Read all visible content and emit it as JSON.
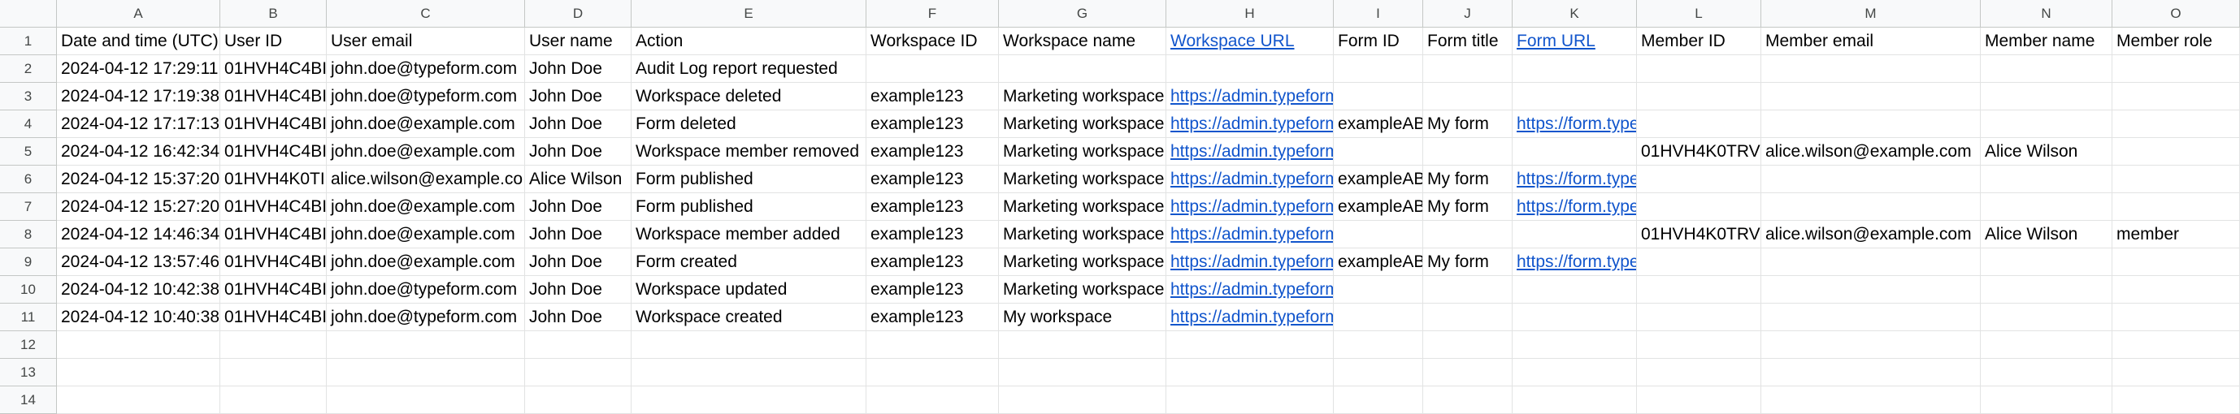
{
  "columns": [
    "A",
    "B",
    "C",
    "D",
    "E",
    "F",
    "G",
    "H",
    "I",
    "J",
    "K",
    "L",
    "M",
    "N",
    "O"
  ],
  "rows": [
    {
      "num": "1",
      "cells": [
        "Date and time (UTC)",
        "User ID",
        "User email",
        "User name",
        "Action",
        "Workspace ID",
        "Workspace name",
        "Workspace URL",
        "Form ID",
        "Form title",
        "Form URL",
        "Member ID",
        "Member email",
        "Member name",
        "Member role"
      ]
    },
    {
      "num": "2",
      "cells": [
        "2024-04-12 17:29:11",
        "01HVH4C4BI",
        "john.doe@typeform.com",
        "John Doe",
        "Audit Log report requested",
        "",
        "",
        "",
        "",
        "",
        "",
        "",
        "",
        "",
        ""
      ]
    },
    {
      "num": "3",
      "cells": [
        "2024-04-12 17:19:38",
        "01HVH4C4BI",
        "john.doe@typeform.com",
        "John Doe",
        "Workspace deleted",
        "example123",
        "Marketing workspace",
        "https://admin.typeform",
        "",
        "",
        "",
        "",
        "",
        "",
        ""
      ]
    },
    {
      "num": "4",
      "cells": [
        "2024-04-12 17:17:13",
        "01HVH4C4BI",
        "john.doe@example.com",
        "John Doe",
        "Form deleted",
        "example123",
        "Marketing workspace",
        "https://admin.typeform",
        "exampleAB",
        "My form",
        "https://form.type",
        "",
        "",
        "",
        ""
      ]
    },
    {
      "num": "5",
      "cells": [
        "2024-04-12 16:42:34",
        "01HVH4C4BI",
        "john.doe@example.com",
        "John Doe",
        "Workspace member removed",
        "example123",
        "Marketing workspace",
        "https://admin.typeform",
        "",
        "",
        "",
        "01HVH4K0TRV",
        "alice.wilson@example.com",
        "Alice Wilson",
        ""
      ]
    },
    {
      "num": "6",
      "cells": [
        "2024-04-12 15:37:20",
        "01HVH4K0TI",
        "alice.wilson@example.co",
        "Alice Wilson",
        "Form published",
        "example123",
        "Marketing workspace",
        "https://admin.typeform",
        "exampleAB",
        "My form",
        "https://form.type",
        "",
        "",
        "",
        ""
      ]
    },
    {
      "num": "7",
      "cells": [
        "2024-04-12 15:27:20",
        "01HVH4C4BI",
        "john.doe@example.com",
        "John Doe",
        "Form published",
        "example123",
        "Marketing workspace",
        "https://admin.typeform",
        "exampleAB",
        "My form",
        "https://form.type",
        "",
        "",
        "",
        ""
      ]
    },
    {
      "num": "8",
      "cells": [
        "2024-04-12 14:46:34",
        "01HVH4C4BI",
        "john.doe@example.com",
        "John Doe",
        "Workspace member added",
        "example123",
        "Marketing workspace",
        "https://admin.typeform",
        "",
        "",
        "",
        "01HVH4K0TRV",
        "alice.wilson@example.com",
        "Alice Wilson",
        "member"
      ]
    },
    {
      "num": "9",
      "cells": [
        "2024-04-12 13:57:46",
        "01HVH4C4BI",
        "john.doe@example.com",
        "John Doe",
        "Form created",
        "example123",
        "Marketing workspace",
        "https://admin.typeform",
        "exampleAB",
        "My form",
        "https://form.type",
        "",
        "",
        "",
        ""
      ]
    },
    {
      "num": "10",
      "cells": [
        "2024-04-12 10:42:38",
        "01HVH4C4BI",
        "john.doe@typeform.com",
        "John Doe",
        "Workspace updated",
        "example123",
        "Marketing workspace",
        "https://admin.typeform",
        "",
        "",
        "",
        "",
        "",
        "",
        ""
      ]
    },
    {
      "num": "11",
      "cells": [
        "2024-04-12 10:40:38",
        "01HVH4C4BI",
        "john.doe@typeform.com",
        "John Doe",
        "Workspace created",
        "example123",
        "My workspace",
        "https://admin.typeform",
        "",
        "",
        "",
        "",
        "",
        "",
        ""
      ]
    },
    {
      "num": "12",
      "cells": [
        "",
        "",
        "",
        "",
        "",
        "",
        "",
        "",
        "",
        "",
        "",
        "",
        "",
        "",
        ""
      ]
    },
    {
      "num": "13",
      "cells": [
        "",
        "",
        "",
        "",
        "",
        "",
        "",
        "",
        "",
        "",
        "",
        "",
        "",
        "",
        ""
      ]
    },
    {
      "num": "14",
      "cells": [
        "",
        "",
        "",
        "",
        "",
        "",
        "",
        "",
        "",
        "",
        "",
        "",
        "",
        "",
        ""
      ]
    }
  ],
  "link_columns": [
    7,
    10
  ],
  "colors": {
    "header_bg": "#f8f9fa",
    "link": "#1155cc",
    "grid": "#e2e3e3"
  }
}
